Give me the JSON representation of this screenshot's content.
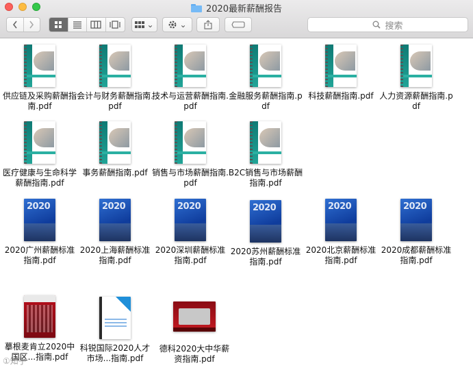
{
  "window": {
    "title": "2020最新薪酬报告"
  },
  "toolbar": {
    "search_placeholder": "搜索",
    "view_options_glyph": "⌄"
  },
  "files": [
    {
      "label": "供应链及采购薪酬指南.pdf",
      "style": "green"
    },
    {
      "label": "会计与财务薪酬指南.pdf",
      "style": "green"
    },
    {
      "label": "技术与运营薪酬指南.pdf",
      "style": "green"
    },
    {
      "label": "金融服务薪酬指南.pdf",
      "style": "green"
    },
    {
      "label": "科技薪酬指南.pdf",
      "style": "green"
    },
    {
      "label": "人力资源薪酬指南.pdf",
      "style": "green"
    },
    {
      "label": "医疗健康与生命科学薪酬指南.pdf",
      "style": "green"
    },
    {
      "label": "事务薪酬指南.pdf",
      "style": "green"
    },
    {
      "label": "销售与市场薪酬指南.pdf",
      "style": "green"
    },
    {
      "label": "B2C销售与市场薪酬指南.pdf",
      "style": "green"
    },
    {
      "label": "2020广州薪酬标准指南.pdf",
      "style": "blue"
    },
    {
      "label": "2020上海薪酬标准指南.pdf",
      "style": "blue"
    },
    {
      "label": "2020深圳薪酬标准指南.pdf",
      "style": "blue"
    },
    {
      "label": "2020苏州薪酬标准指南.pdf",
      "style": "blue"
    },
    {
      "label": "2020北京薪酬标准指南.pdf",
      "style": "blue"
    },
    {
      "label": "2020成都薪酬标准指南.pdf",
      "style": "blue"
    },
    {
      "label": "摹根麦肯立2020中国区...指南.pdf",
      "style": "red"
    },
    {
      "label": "科锐国际2020人才市场...指南.pdf",
      "style": "white"
    },
    {
      "label": "德科2020大中华薪资指南.pdf",
      "style": "wide"
    }
  ],
  "cover_text": {
    "year": "2020"
  },
  "watermark": "①知乎"
}
